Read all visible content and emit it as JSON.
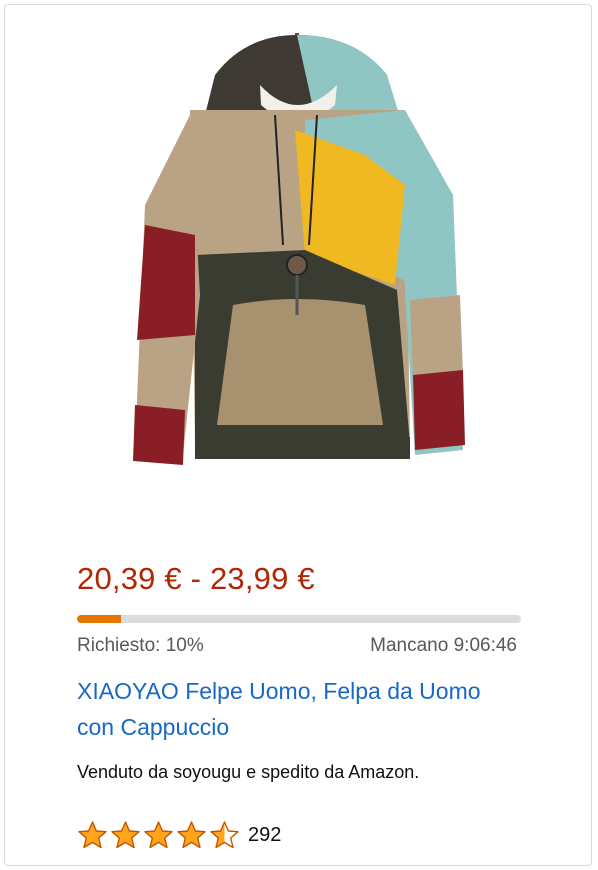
{
  "product": {
    "image_alt": "patchwork hoodie",
    "price": "20,39 € - 23,99 €",
    "claimed_label": "Richiesto: 10%",
    "claimed_fraction": 0.1,
    "timer_label": "Mancano 9:06:46",
    "title": "XIAOYAO Felpe Uomo, Felpa da Uomo con Cappuccio",
    "seller_info": "Venduto da soyougu e spedito da Amazon.",
    "rating": 4.5,
    "review_count": "292"
  },
  "colors": {
    "price": "#b12704",
    "progress_fill": "#e77600",
    "progress_track": "#dcdcdc",
    "link": "#1769c4",
    "star": "#ffa41c"
  }
}
